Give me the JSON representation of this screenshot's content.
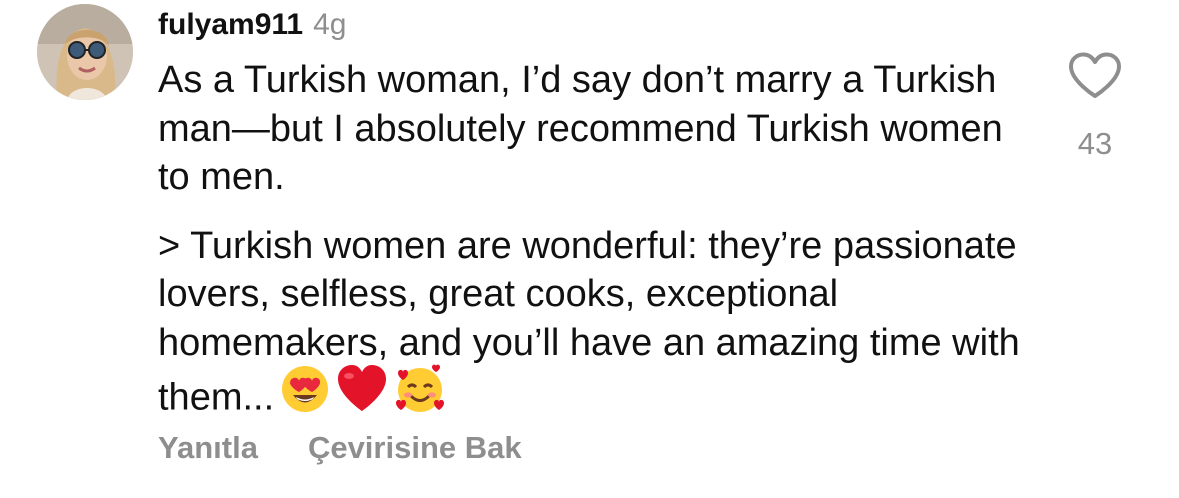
{
  "comment": {
    "username": "fulyam911",
    "timestamp": "4g",
    "paragraph1": "As a Turkish woman, I’d say don’t marry a Turkish man—but I absolutely recommend Turkish women to men.",
    "paragraph2": "> Turkish women are wonderful: they’re passionate lovers, selfless, great cooks, exceptional homemakers, and you’ll have an amazing time with them...",
    "emojis": [
      "heart-eyes-emoji",
      "red-heart-emoji",
      "smiling-face-with-hearts-emoji"
    ],
    "like_count": "43",
    "like_icon": "heart-outline-icon",
    "avatar": "user-avatar-photo",
    "actions": {
      "reply_label": "Yanıtla",
      "translate_label": "Çevirisine Bak"
    }
  },
  "colors": {
    "text": "#111111",
    "secondary": "#8e8e8e",
    "background": "#ffffff"
  }
}
